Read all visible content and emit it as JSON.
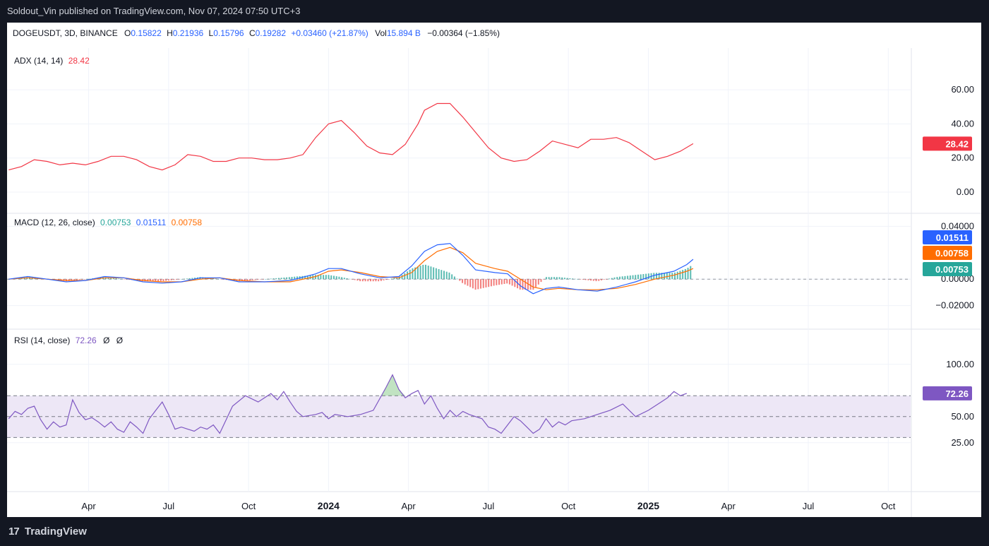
{
  "header": {
    "publisher": "Soldout_Vin published on TradingView.com, Nov 07, 2024 07:50 UTC+3"
  },
  "symbol": {
    "name": "DOGEUSDT, 3D, BINANCE",
    "o_label": "O",
    "o": "0.15822",
    "h_label": "H",
    "h": "0.21936",
    "l_label": "L",
    "l": "0.15796",
    "c_label": "C",
    "c": "0.19282",
    "change": "+0.03460 (+21.87%)",
    "vol_label": "Vol",
    "vol": "15.894 B",
    "vol_change": "−0.00364 (−1.85%)"
  },
  "footer": {
    "logo": "17",
    "brand": "TradingView"
  },
  "colors": {
    "adx": "#f23645",
    "macd": "#2962ff",
    "signal": "#ff6d00",
    "hist_pos": "#26a69a",
    "hist_neg": "#ef5350",
    "rsi": "#7e57c2",
    "rsi_band": "#ede7f6",
    "rsi_ob": "#4caf50",
    "grid": "#f0f3fa"
  },
  "chart_data": [
    {
      "type": "line",
      "name": "ADX",
      "legend": {
        "label": "ADX (14, 14)",
        "value": "28.42"
      },
      "y_ticks": [
        "60.00",
        "40.00",
        "20.00",
        "0.00"
      ],
      "ylim": [
        0,
        70
      ],
      "last_label": "28.42",
      "points": [
        [
          2023.0,
          13
        ],
        [
          2023.04,
          15
        ],
        [
          2023.08,
          19
        ],
        [
          2023.12,
          18
        ],
        [
          2023.16,
          16
        ],
        [
          2023.2,
          17
        ],
        [
          2023.24,
          16
        ],
        [
          2023.28,
          18
        ],
        [
          2023.32,
          21
        ],
        [
          2023.36,
          21
        ],
        [
          2023.4,
          19
        ],
        [
          2023.44,
          15
        ],
        [
          2023.48,
          13
        ],
        [
          2023.52,
          16
        ],
        [
          2023.56,
          22
        ],
        [
          2023.6,
          21
        ],
        [
          2023.64,
          18
        ],
        [
          2023.68,
          18
        ],
        [
          2023.72,
          20
        ],
        [
          2023.76,
          20
        ],
        [
          2023.8,
          19
        ],
        [
          2023.84,
          19
        ],
        [
          2023.88,
          20
        ],
        [
          2023.92,
          22
        ],
        [
          2023.96,
          32
        ],
        [
          2024.0,
          40
        ],
        [
          2024.04,
          42
        ],
        [
          2024.08,
          35
        ],
        [
          2024.12,
          27
        ],
        [
          2024.16,
          23
        ],
        [
          2024.2,
          22
        ],
        [
          2024.24,
          28
        ],
        [
          2024.28,
          40
        ],
        [
          2024.3,
          48
        ],
        [
          2024.34,
          52
        ],
        [
          2024.38,
          52
        ],
        [
          2024.42,
          44
        ],
        [
          2024.46,
          35
        ],
        [
          2024.5,
          26
        ],
        [
          2024.54,
          20
        ],
        [
          2024.58,
          18
        ],
        [
          2024.62,
          19
        ],
        [
          2024.66,
          24
        ],
        [
          2024.7,
          30
        ],
        [
          2024.74,
          28
        ],
        [
          2024.78,
          26
        ],
        [
          2024.82,
          31
        ],
        [
          2024.86,
          31
        ],
        [
          2024.9,
          32
        ],
        [
          2024.94,
          29
        ],
        [
          2024.98,
          24
        ],
        [
          2025.02,
          19
        ],
        [
          2025.06,
          21
        ],
        [
          2025.1,
          24
        ],
        [
          2025.14,
          28.42
        ]
      ]
    },
    {
      "type": "line",
      "name": "MACD",
      "legend": {
        "label": "MACD (12, 26, close)",
        "macd": "0.00753",
        "signal": "0.01511",
        "hist": "0.00758"
      },
      "y_ticks": [
        "0.04000",
        "0.00000",
        "−0.02000"
      ],
      "ylim": [
        -0.025,
        0.045
      ],
      "last_labels": [
        "0.01511",
        "0.00758",
        "0.00753"
      ],
      "macd_points": [
        [
          2023.0,
          0.0
        ],
        [
          2023.06,
          0.002
        ],
        [
          2023.12,
          0.0
        ],
        [
          2023.18,
          -0.002
        ],
        [
          2023.24,
          -0.001
        ],
        [
          2023.3,
          0.002
        ],
        [
          2023.36,
          0.001
        ],
        [
          2023.42,
          -0.002
        ],
        [
          2023.48,
          -0.003
        ],
        [
          2023.54,
          -0.002
        ],
        [
          2023.6,
          0.001
        ],
        [
          2023.66,
          0.001
        ],
        [
          2023.72,
          -0.002
        ],
        [
          2023.8,
          -0.002
        ],
        [
          2023.88,
          -0.001
        ],
        [
          2023.96,
          0.004
        ],
        [
          2024.0,
          0.008
        ],
        [
          2024.04,
          0.008
        ],
        [
          2024.1,
          0.004
        ],
        [
          2024.16,
          0.001
        ],
        [
          2024.22,
          0.002
        ],
        [
          2024.26,
          0.01
        ],
        [
          2024.3,
          0.021
        ],
        [
          2024.34,
          0.026
        ],
        [
          2024.38,
          0.027
        ],
        [
          2024.42,
          0.018
        ],
        [
          2024.46,
          0.007
        ],
        [
          2024.52,
          0.005
        ],
        [
          2024.56,
          0.004
        ],
        [
          2024.6,
          -0.005
        ],
        [
          2024.64,
          -0.011
        ],
        [
          2024.68,
          -0.007
        ],
        [
          2024.72,
          -0.006
        ],
        [
          2024.78,
          -0.008
        ],
        [
          2024.84,
          -0.009
        ],
        [
          2024.9,
          -0.006
        ],
        [
          2024.96,
          -0.002
        ],
        [
          2025.02,
          0.003
        ],
        [
          2025.08,
          0.006
        ],
        [
          2025.12,
          0.011
        ],
        [
          2025.14,
          0.015
        ]
      ],
      "signal_points": [
        [
          2023.0,
          0.0
        ],
        [
          2023.06,
          0.001
        ],
        [
          2023.12,
          0.0
        ],
        [
          2023.18,
          -0.001
        ],
        [
          2023.24,
          -0.001
        ],
        [
          2023.3,
          0.001
        ],
        [
          2023.36,
          0.001
        ],
        [
          2023.42,
          -0.001
        ],
        [
          2023.48,
          -0.002
        ],
        [
          2023.54,
          -0.002
        ],
        [
          2023.6,
          0.0
        ],
        [
          2023.66,
          0.001
        ],
        [
          2023.72,
          -0.001
        ],
        [
          2023.8,
          -0.002
        ],
        [
          2023.88,
          -0.002
        ],
        [
          2023.96,
          0.002
        ],
        [
          2024.0,
          0.006
        ],
        [
          2024.04,
          0.007
        ],
        [
          2024.1,
          0.005
        ],
        [
          2024.16,
          0.002
        ],
        [
          2024.22,
          0.001
        ],
        [
          2024.26,
          0.005
        ],
        [
          2024.3,
          0.014
        ],
        [
          2024.34,
          0.021
        ],
        [
          2024.38,
          0.024
        ],
        [
          2024.42,
          0.02
        ],
        [
          2024.46,
          0.012
        ],
        [
          2024.52,
          0.008
        ],
        [
          2024.56,
          0.006
        ],
        [
          2024.6,
          0.0
        ],
        [
          2024.64,
          -0.006
        ],
        [
          2024.68,
          -0.008
        ],
        [
          2024.72,
          -0.007
        ],
        [
          2024.78,
          -0.008
        ],
        [
          2024.84,
          -0.008
        ],
        [
          2024.9,
          -0.007
        ],
        [
          2024.96,
          -0.004
        ],
        [
          2025.02,
          0.0
        ],
        [
          2025.08,
          0.003
        ],
        [
          2025.12,
          0.006
        ],
        [
          2025.14,
          0.008
        ]
      ]
    },
    {
      "type": "line",
      "name": "RSI",
      "legend": {
        "label": "RSI (14, close)",
        "value": "72.26",
        "extra1": "Ø",
        "extra2": "Ø"
      },
      "y_ticks": [
        "100.00",
        "50.00",
        "25.00"
      ],
      "ylim": [
        10,
        110
      ],
      "bands": [
        30,
        50,
        70
      ],
      "last_label": "72.26",
      "points": [
        [
          2023.0,
          48
        ],
        [
          2023.02,
          55
        ],
        [
          2023.04,
          52
        ],
        [
          2023.06,
          58
        ],
        [
          2023.08,
          60
        ],
        [
          2023.1,
          47
        ],
        [
          2023.12,
          38
        ],
        [
          2023.14,
          45
        ],
        [
          2023.16,
          40
        ],
        [
          2023.18,
          42
        ],
        [
          2023.2,
          66
        ],
        [
          2023.22,
          54
        ],
        [
          2023.24,
          47
        ],
        [
          2023.26,
          49
        ],
        [
          2023.28,
          45
        ],
        [
          2023.3,
          40
        ],
        [
          2023.32,
          45
        ],
        [
          2023.34,
          38
        ],
        [
          2023.36,
          35
        ],
        [
          2023.38,
          45
        ],
        [
          2023.4,
          40
        ],
        [
          2023.42,
          34
        ],
        [
          2023.44,
          48
        ],
        [
          2023.46,
          56
        ],
        [
          2023.48,
          64
        ],
        [
          2023.5,
          52
        ],
        [
          2023.52,
          38
        ],
        [
          2023.54,
          40
        ],
        [
          2023.56,
          38
        ],
        [
          2023.58,
          36
        ],
        [
          2023.6,
          40
        ],
        [
          2023.62,
          38
        ],
        [
          2023.64,
          42
        ],
        [
          2023.66,
          34
        ],
        [
          2023.7,
          60
        ],
        [
          2023.74,
          70
        ],
        [
          2023.78,
          64
        ],
        [
          2023.82,
          72
        ],
        [
          2023.84,
          66
        ],
        [
          2023.86,
          74
        ],
        [
          2023.88,
          64
        ],
        [
          2023.9,
          55
        ],
        [
          2023.92,
          50
        ],
        [
          2023.96,
          52
        ],
        [
          2023.98,
          54
        ],
        [
          2024.0,
          48
        ],
        [
          2024.02,
          52
        ],
        [
          2024.06,
          50
        ],
        [
          2024.1,
          52
        ],
        [
          2024.14,
          56
        ],
        [
          2024.18,
          78
        ],
        [
          2024.2,
          90
        ],
        [
          2024.22,
          76
        ],
        [
          2024.24,
          68
        ],
        [
          2024.26,
          72
        ],
        [
          2024.28,
          75
        ],
        [
          2024.3,
          62
        ],
        [
          2024.32,
          70
        ],
        [
          2024.34,
          58
        ],
        [
          2024.36,
          48
        ],
        [
          2024.38,
          56
        ],
        [
          2024.4,
          50
        ],
        [
          2024.42,
          55
        ],
        [
          2024.44,
          52
        ],
        [
          2024.46,
          50
        ],
        [
          2024.48,
          48
        ],
        [
          2024.5,
          40
        ],
        [
          2024.52,
          38
        ],
        [
          2024.54,
          34
        ],
        [
          2024.56,
          42
        ],
        [
          2024.58,
          50
        ],
        [
          2024.6,
          46
        ],
        [
          2024.62,
          40
        ],
        [
          2024.64,
          34
        ],
        [
          2024.66,
          38
        ],
        [
          2024.68,
          48
        ],
        [
          2024.7,
          40
        ],
        [
          2024.72,
          45
        ],
        [
          2024.74,
          42
        ],
        [
          2024.76,
          46
        ],
        [
          2024.8,
          48
        ],
        [
          2024.84,
          52
        ],
        [
          2024.88,
          56
        ],
        [
          2024.92,
          62
        ],
        [
          2024.96,
          50
        ],
        [
          2025.0,
          56
        ],
        [
          2025.04,
          64
        ],
        [
          2025.06,
          68
        ],
        [
          2025.08,
          74
        ],
        [
          2025.1,
          70
        ],
        [
          2025.12,
          72.26
        ]
      ]
    }
  ],
  "x_axis": {
    "ticks": [
      {
        "label": "Apr",
        "x": 2023.25,
        "bold": false
      },
      {
        "label": "Jul",
        "x": 2023.5,
        "bold": false
      },
      {
        "label": "Oct",
        "x": 2023.75,
        "bold": false
      },
      {
        "label": "2024",
        "x": 2024.0,
        "bold": true
      },
      {
        "label": "Apr",
        "x": 2024.25,
        "bold": false
      },
      {
        "label": "Jul",
        "x": 2024.5,
        "bold": false
      },
      {
        "label": "Oct",
        "x": 2024.75,
        "bold": false
      },
      {
        "label": "2025",
        "x": 2025.0,
        "bold": true
      },
      {
        "label": "Apr",
        "x": 2025.25,
        "bold": false
      },
      {
        "label": "Jul",
        "x": 2025.5,
        "bold": false
      },
      {
        "label": "Oct",
        "x": 2025.75,
        "bold": false
      }
    ]
  }
}
